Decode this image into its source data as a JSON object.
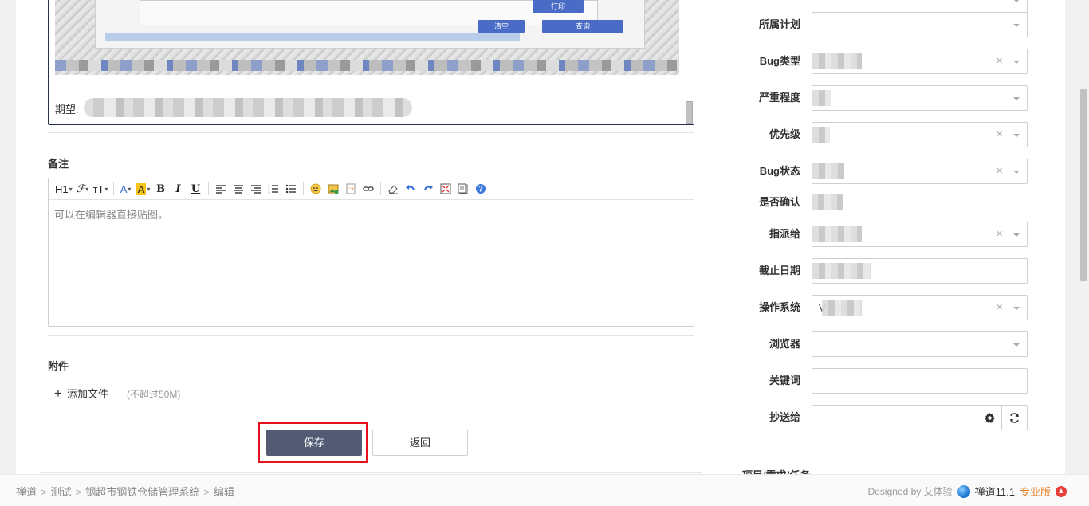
{
  "steps": {
    "mini_print_label": "打印",
    "mini_left_label": "清空",
    "mini_right_label": "查询",
    "expect_label": "期望:"
  },
  "remark": {
    "label": "备注",
    "placeholder": "可以在编辑器直接贴图。",
    "toolbar": {
      "heading": "H1",
      "font_family": "ℱ",
      "font_size": "ᴛT",
      "font_color": "A",
      "highlight": "A",
      "bold": "B",
      "italic": "I",
      "underline": "U"
    }
  },
  "attachments": {
    "label": "附件",
    "add_label": "添加文件",
    "hint": "(不超过50M)"
  },
  "actions": {
    "save_label": "保存",
    "back_label": "返回"
  },
  "fields": {
    "plan_label": "所属计划",
    "bug_type_label": "Bug类型",
    "severity_label": "严重程度",
    "priority_label": "优先级",
    "bug_status_label": "Bug状态",
    "confirmed_label": "是否确认",
    "assigned_to_label": "指派给",
    "deadline_label": "截止日期",
    "os_label": "操作系统",
    "os_value": "V",
    "browser_label": "浏览器",
    "keywords_label": "关键词",
    "cc_label": "抄送给",
    "clear_symbol": "×",
    "next_section_label": "项目/需求/任务"
  },
  "footer": {
    "breadcrumbs": [
      "禅道",
      "测试",
      "钢超市钢铁仓储管理系统",
      "编辑"
    ],
    "designed_by": "Designed by 艾体验",
    "version": "禅道11.1",
    "edition": "专业版",
    "separator": ">"
  },
  "colors": {
    "save_button": "#525b73",
    "highlight_border": "#e4131b",
    "edition": "#e67e22"
  }
}
